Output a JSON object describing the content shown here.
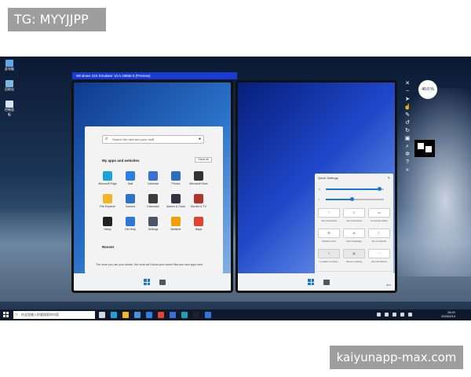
{
  "watermarks": {
    "top": "TG: MYYJJPP",
    "bottom": "kaiyunapp-max.com"
  },
  "desktop": {
    "icons": [
      {
        "name": "recycle-bin-icon",
        "label": "此电脑",
        "color": "#5fa8e8"
      },
      {
        "name": "network-icon",
        "label": "回收站",
        "color": "#7fb6e0"
      },
      {
        "name": "folder-icon",
        "label": "控制面板",
        "color": "#d6e6f5"
      }
    ]
  },
  "emulator": {
    "title": "Windows 10X Emulator 10.0.19556.0 (Preview)",
    "zoom": "40.0 %"
  },
  "start_menu": {
    "search_placeholder": "Search the web and your stuff",
    "apps_title": "My apps and websites",
    "show_all": "Show all",
    "apps": [
      {
        "label": "Microsoft Edge",
        "color": "#1aa3d9"
      },
      {
        "label": "Mail",
        "color": "#2f7fe0"
      },
      {
        "label": "Calendar",
        "color": "#3a6fd8"
      },
      {
        "label": "Photos",
        "color": "#2b6cc4"
      },
      {
        "label": "Microsoft Store",
        "color": "#333333"
      },
      {
        "label": "File Explorer",
        "color": "#f2b624"
      },
      {
        "label": "Camera",
        "color": "#2c73c9"
      },
      {
        "label": "Calculator",
        "color": "#3b3b3b"
      },
      {
        "label": "Alarms & Clock",
        "color": "#2f3540"
      },
      {
        "label": "Movies & TV",
        "color": "#b3322a"
      },
      {
        "label": "Sticky",
        "color": "#222222"
      },
      {
        "label": "Get Help",
        "color": "#2b78d8"
      },
      {
        "label": "Settings",
        "color": "#4a5568"
      },
      {
        "label": "Weather",
        "color": "#f0a000"
      },
      {
        "label": "Maps",
        "color": "#e0432f"
      }
    ],
    "recent_title": "Recent",
    "recent_text": "The more you use your device, the more we'll show your recent files and new apps here."
  },
  "quick_settings": {
    "title": "Quick Settings",
    "edit": "Edit",
    "brightness_level": 0.92,
    "volume_level": 0.45,
    "tiles_row1": [
      {
        "label": "Not connected",
        "icon": "wifi-icon",
        "dim": false
      },
      {
        "label": "Not connected",
        "icon": "bluetooth-icon",
        "dim": false
      },
      {
        "label": "Computer Mode",
        "icon": "tablet-icon",
        "dim": false
      }
    ],
    "tiles_row2": [
      {
        "label": "Rotation lock",
        "icon": "rotation-icon",
        "dim": false
      },
      {
        "label": "Input language",
        "icon": "language-icon",
        "dim": false
      },
      {
        "label": "Do not disturb",
        "icon": "moon-icon",
        "dim": false
      }
    ],
    "tiles_row3": [
      {
        "label": "Location services",
        "icon": "location-icon",
        "dim": true
      },
      {
        "label": "Screen casting",
        "icon": "cast-icon",
        "dim": true
      },
      {
        "label": "See all Actions",
        "icon": "actions-icon",
        "dim": false
      }
    ],
    "time": "8:01"
  },
  "taskbar": {
    "search_placeholder": "在这里输入你要搜索的内容",
    "apps": [
      {
        "name": "task-view-icon",
        "color": "#cfd8e3"
      },
      {
        "name": "edge-icon",
        "color": "#1aa3d9"
      },
      {
        "name": "explorer-icon",
        "color": "#f2b624"
      },
      {
        "name": "store-icon",
        "color": "#4a90e2"
      },
      {
        "name": "mail-icon",
        "color": "#2f7fe0"
      },
      {
        "name": "chrome-icon",
        "color": "#e94235"
      },
      {
        "name": "app-icon",
        "color": "#3a6fd8"
      },
      {
        "name": "emulator-icon",
        "color": "#1aa0b8"
      },
      {
        "name": "terminal-icon",
        "color": "#222"
      },
      {
        "name": "hyperv-icon",
        "color": "#2b78d8"
      }
    ],
    "time": "16:21",
    "date": "2020/2/14"
  }
}
